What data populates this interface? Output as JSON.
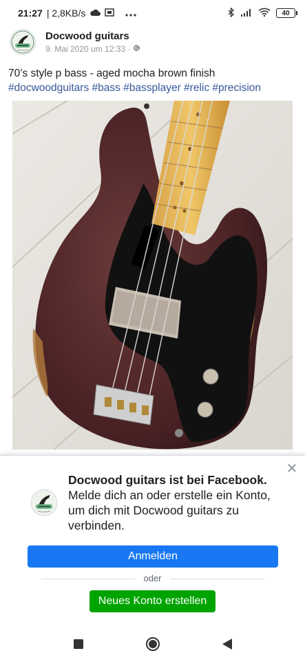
{
  "status_bar": {
    "time": "21:27",
    "network_speed": "| 2,8KB/s",
    "battery": "40",
    "icons": [
      "cloud-icon",
      "screen-icon",
      "more-dots-icon",
      "bluetooth-icon",
      "signal-icon",
      "wifi-icon",
      "battery-icon"
    ]
  },
  "post": {
    "page_name": "Docwood guitars",
    "date": "9. Mai 2020 um 12:33 ·",
    "privacy_icon": "globe-icon",
    "caption": "70’s style p bass - aged mocha brown finish",
    "hashtags": "#docwoodguitars #bass #bassplayer #relic #precision"
  },
  "login_prompt": {
    "title": "Docwood guitars ist bei Facebook.",
    "message": "Melde dich an oder erstelle ein Konto, um dich mit Docwood guitars zu verbinden.",
    "login_button": "Anmelden",
    "separator": "oder",
    "register_button": "Neues Konto erstellen"
  },
  "nav": {
    "icons": [
      "recents-square-icon",
      "home-circle-icon",
      "back-triangle-icon"
    ]
  },
  "colors": {
    "login_blue": "#1877f2",
    "register_green": "#00a400",
    "hashtag_blue": "#385898"
  }
}
